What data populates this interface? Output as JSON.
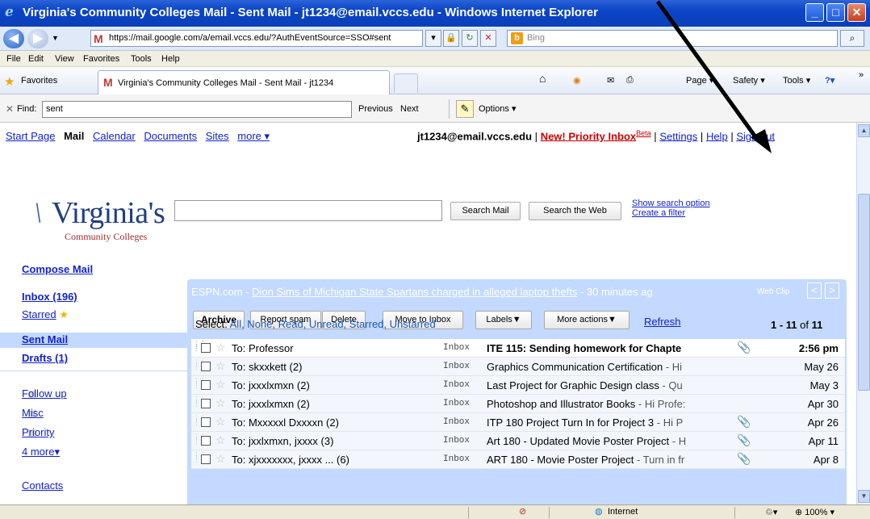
{
  "window": {
    "title": "Virginia's Community Colleges Mail - Sent Mail -  jt1234@email.vccs.edu - Windows Internet Explorer",
    "min_label": "_",
    "max_label": "□",
    "close_label": "✕"
  },
  "address_bar": {
    "url": "https://mail.google.com/a/email.vccs.edu/?AuthEventSource=SSO#sent",
    "search_placeholder": "Bing"
  },
  "menu": [
    "File",
    "Edit",
    "View",
    "Favorites",
    "Tools",
    "Help"
  ],
  "favorites_bar": {
    "favorites_label": "Favorites",
    "tab_title": "Virginia's Community Colleges Mail - Sent Mail - jt1234",
    "commands": [
      "Page ▾",
      "Safety ▾",
      "Tools ▾"
    ]
  },
  "find_bar": {
    "label": "Find:",
    "value": "sent",
    "previous": "Previous",
    "next": "Next",
    "options": "Options ▾"
  },
  "top_nav": {
    "links": [
      "Start Page",
      "Mail",
      "Calendar",
      "Documents",
      "Sites",
      "more ▾"
    ],
    "account": "jt1234@email.vccs.edu",
    "sep": "|",
    "priority_inbox": "New! Priority Inbox",
    "beta": "Beta",
    "settings": "Settings",
    "help": "Help",
    "sign_out": "Sign out"
  },
  "logo": {
    "name": "Virginia's",
    "sub": "Community Colleges"
  },
  "search": {
    "search_mail": "Search Mail",
    "search_web": "Search the Web",
    "show_options": "Show search option",
    "create_filter": "Create a filter"
  },
  "sidebar": {
    "compose": "Compose Mail",
    "inbox": "Inbox (196)",
    "starred": "Starred",
    "sent": "Sent Mail",
    "drafts": "Drafts (1)",
    "labels": [
      "Follow up",
      "Misc",
      "Priority"
    ],
    "more": "4 more▾",
    "contacts": "Contacts"
  },
  "web_clip": {
    "source": "ESPN.com - ",
    "headline": "Dion Sims of Michigan State Spartans charged in alleged laptop thefts",
    "age": " - 30 minutes ag",
    "tag": "Web Clip",
    "prev": "<",
    "next": ">"
  },
  "actions": {
    "archive": "Archive",
    "report_spam": "Report spam",
    "delete": "Delete",
    "move_inbox": "Move to Inbox",
    "labels": "Labels▼",
    "more_actions": "More actions▼",
    "refresh": "Refresh",
    "count_range": "1 - 11",
    "count_of": " of ",
    "count_total": "11"
  },
  "select": {
    "label": "Select: ",
    "options": "All, None, Read, Unread, Starred, Unstarred"
  },
  "messages": [
    {
      "to": "To:  Professor",
      "label": "Inbox",
      "subject": "ITE 115: Sending homework for Chapte",
      "snippet": "",
      "attach": true,
      "date": "2:56 pm",
      "unread": true
    },
    {
      "to": "To: skxxkett (2)",
      "label": "Inbox",
      "subject": "Graphics Communication Certification",
      "snippet": " - Hi",
      "attach": false,
      "date": "May 26",
      "unread": false
    },
    {
      "to": "To: jxxxlxmxn (2)",
      "label": "Inbox",
      "subject": "Last Project for Graphic Design class",
      "snippet": " - Qu",
      "attach": false,
      "date": "May 3",
      "unread": false
    },
    {
      "to": "To: jxxxlxmxn (2)",
      "label": "Inbox",
      "subject": "Photoshop and Illustrator Books",
      "snippet": " - Hi Profe:",
      "attach": false,
      "date": "Apr 30",
      "unread": false
    },
    {
      "to": "To: Mxxxxxl Dxxxxn (2)",
      "label": "Inbox",
      "subject": "ITP 180 Project Turn In for Project 3",
      "snippet": " - Hi P",
      "attach": true,
      "date": "Apr 26",
      "unread": false
    },
    {
      "to": "To: jxxlxmxn, jxxxx (3)",
      "label": "Inbox",
      "subject": "Art 180 - Updated Movie Poster Project",
      "snippet": " - H",
      "attach": true,
      "date": "Apr 11",
      "unread": false
    },
    {
      "to": "To: xjxxxxxxx, jxxxx ... (6)",
      "label": "Inbox",
      "subject": "ART 180 - Movie Poster Project",
      "snippet": " - Turn in fr",
      "attach": true,
      "date": "Apr 8",
      "unread": false
    }
  ],
  "status_bar": {
    "zone": "Internet",
    "zoom": "100%"
  },
  "colors": {
    "title_bar": "#0b45c7",
    "panel": "#c3d9ff",
    "link": "#1122cc",
    "priority_link": "#cc0000"
  }
}
